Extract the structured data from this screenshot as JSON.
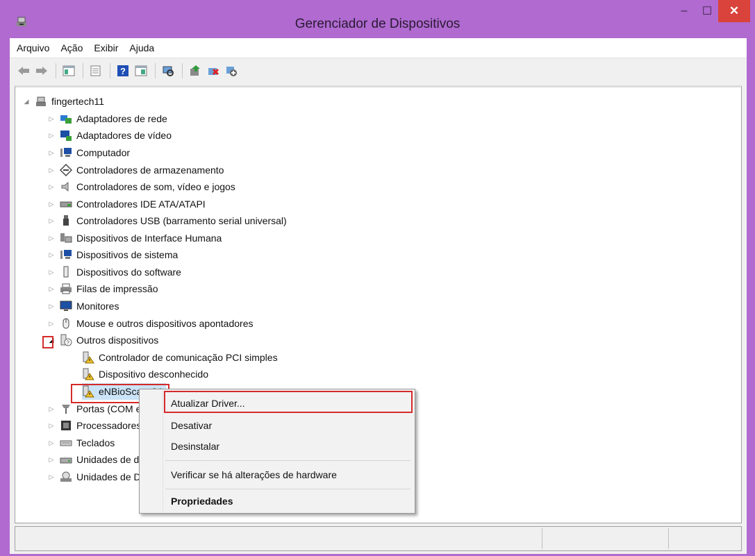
{
  "window": {
    "title": "Gerenciador de Dispositivos",
    "min": "–",
    "max": "☐",
    "close": "✕"
  },
  "menu": [
    "Arquivo",
    "Ação",
    "Exibir",
    "Ajuda"
  ],
  "toolbar_icons": [
    "back-arrow-icon",
    "forward-arrow-icon",
    "show-hide-tree-icon",
    "properties-icon",
    "help-icon",
    "view-icon",
    "scan-hardware-icon",
    "update-driver-icon",
    "uninstall-icon",
    "disable-icon"
  ],
  "tree": {
    "root": "fingertech11",
    "categories": [
      "Adaptadores de rede",
      "Adaptadores de vídeo",
      "Computador",
      "Controladores de armazenamento",
      "Controladores de som, vídeo e jogos",
      "Controladores IDE ATA/ATAPI",
      "Controladores USB (barramento serial universal)",
      "Dispositivos de Interface Humana",
      "Dispositivos de sistema",
      "Dispositivos do software",
      "Filas de impressão",
      "Monitores",
      "Mouse e outros dispositivos apontadores"
    ],
    "expanded_category": "Outros dispositivos",
    "children": [
      "Controlador de comunicação PCI simples",
      "Dispositivo desconhecido",
      "eNBioScan-C1"
    ],
    "after": [
      "Portas (COM e LPT)",
      "Processadores",
      "Teclados",
      "Unidades de disco",
      "Unidades de DVD/CD-ROM"
    ]
  },
  "context_menu": {
    "update": "Atualizar Driver...",
    "disable": "Desativar",
    "uninstall": "Desinstalar",
    "scan": "Verificar se há alterações de hardware",
    "properties": "Propriedades"
  }
}
